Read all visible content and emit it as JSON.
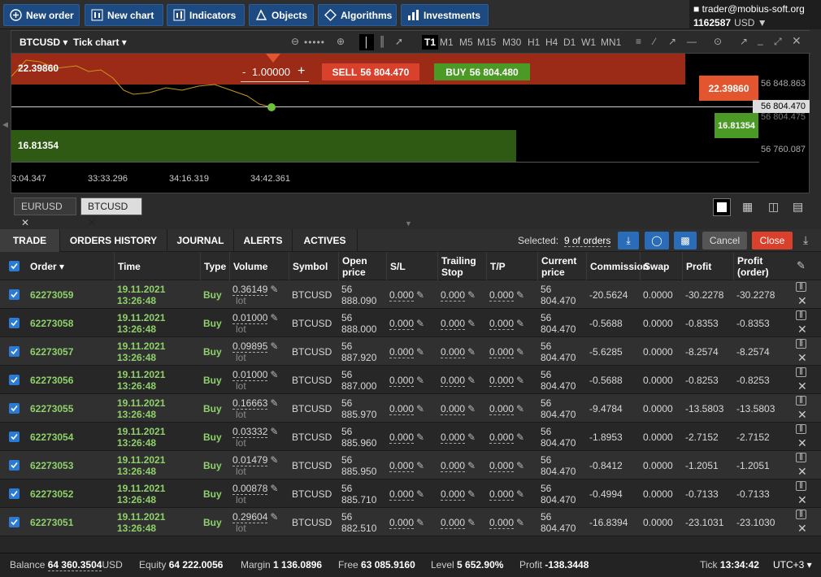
{
  "toolbar": {
    "new_order": "New order",
    "new_chart": "New chart",
    "indicators": "Indicators",
    "objects": "Objects",
    "algorithms": "Algorithms",
    "investments": "Investments"
  },
  "account": {
    "email": "trader@mobius-soft.org",
    "number": "1162587",
    "currency": "USD ▼"
  },
  "chart": {
    "symbol": "BTCUSD ▾",
    "type": "Tick chart ▾",
    "timeframes": [
      "T1",
      "M1",
      "M5",
      "M15",
      "M30",
      "H1",
      "H4",
      "D1",
      "W1",
      "MN1"
    ],
    "active_tf": "T1",
    "volume": "1.00000",
    "volume_minus": "-",
    "volume_plus": "+",
    "sell_label": "SELL",
    "sell_price": "56 804.470",
    "buy_label": "BUY",
    "buy_price": "56 804.480",
    "top_value": "22.39860",
    "top_value_badge": "22.39860",
    "bottom_value": "16.81354",
    "bottom_value_badge": "16.81354",
    "price_ticks": [
      "56 848.863",
      "56 804.470",
      "56 804.475",
      "56 760.087"
    ],
    "time_ticks": [
      "3:04.347",
      "33:33.296",
      "34:16.319",
      "34:42.361"
    ]
  },
  "chart_tabs": [
    "EURUSD",
    "BTCUSD"
  ],
  "panel": {
    "tabs": [
      "TRADE",
      "ORDERS HISTORY",
      "JOURNAL",
      "ALERTS",
      "ACTIVES"
    ],
    "selected_label": "Selected:",
    "selected_value": "9 of orders",
    "cancel": "Cancel",
    "close": "Close"
  },
  "columns": [
    "Order ▾",
    "Time",
    "Type",
    "Volume",
    "Symbol",
    "Open price",
    "S/L",
    "Trailing Stop",
    "T/P",
    "Current price",
    "Commission",
    "Swap",
    "Profit",
    "Profit (order)"
  ],
  "rows": [
    {
      "order": "62273059",
      "date": "19.11.2021",
      "time": "13:26:48",
      "type": "Buy",
      "vol": "0.36149",
      "unit": "lot",
      "sym": "BTCUSD",
      "op1": "56",
      "op2": "888.090",
      "sl": "0.000",
      "ts": "0.000",
      "tp": "0.000",
      "cp1": "56",
      "cp2": "804.470",
      "comm": "-20.5624",
      "swap": "0.0000",
      "profit": "-30.2278",
      "porder": "-30.2278"
    },
    {
      "order": "62273058",
      "date": "19.11.2021",
      "time": "13:26:48",
      "type": "Buy",
      "vol": "0.01000",
      "unit": "lot",
      "sym": "BTCUSD",
      "op1": "56",
      "op2": "888.000",
      "sl": "0.000",
      "ts": "0.000",
      "tp": "0.000",
      "cp1": "56",
      "cp2": "804.470",
      "comm": "-0.5688",
      "swap": "0.0000",
      "profit": "-0.8353",
      "porder": "-0.8353"
    },
    {
      "order": "62273057",
      "date": "19.11.2021",
      "time": "13:26:48",
      "type": "Buy",
      "vol": "0.09895",
      "unit": "lot",
      "sym": "BTCUSD",
      "op1": "56",
      "op2": "887.920",
      "sl": "0.000",
      "ts": "0.000",
      "tp": "0.000",
      "cp1": "56",
      "cp2": "804.470",
      "comm": "-5.6285",
      "swap": "0.0000",
      "profit": "-8.2574",
      "porder": "-8.2574"
    },
    {
      "order": "62273056",
      "date": "19.11.2021",
      "time": "13:26:48",
      "type": "Buy",
      "vol": "0.01000",
      "unit": "lot",
      "sym": "BTCUSD",
      "op1": "56",
      "op2": "887.000",
      "sl": "0.000",
      "ts": "0.000",
      "tp": "0.000",
      "cp1": "56",
      "cp2": "804.470",
      "comm": "-0.5688",
      "swap": "0.0000",
      "profit": "-0.8253",
      "porder": "-0.8253"
    },
    {
      "order": "62273055",
      "date": "19.11.2021",
      "time": "13:26:48",
      "type": "Buy",
      "vol": "0.16663",
      "unit": "lot",
      "sym": "BTCUSD",
      "op1": "56",
      "op2": "885.970",
      "sl": "0.000",
      "ts": "0.000",
      "tp": "0.000",
      "cp1": "56",
      "cp2": "804.470",
      "comm": "-9.4784",
      "swap": "0.0000",
      "profit": "-13.5803",
      "porder": "-13.5803"
    },
    {
      "order": "62273054",
      "date": "19.11.2021",
      "time": "13:26:48",
      "type": "Buy",
      "vol": "0.03332",
      "unit": "lot",
      "sym": "BTCUSD",
      "op1": "56",
      "op2": "885.960",
      "sl": "0.000",
      "ts": "0.000",
      "tp": "0.000",
      "cp1": "56",
      "cp2": "804.470",
      "comm": "-1.8953",
      "swap": "0.0000",
      "profit": "-2.7152",
      "porder": "-2.7152"
    },
    {
      "order": "62273053",
      "date": "19.11.2021",
      "time": "13:26:48",
      "type": "Buy",
      "vol": "0.01479",
      "unit": "lot",
      "sym": "BTCUSD",
      "op1": "56",
      "op2": "885.950",
      "sl": "0.000",
      "ts": "0.000",
      "tp": "0.000",
      "cp1": "56",
      "cp2": "804.470",
      "comm": "-0.8412",
      "swap": "0.0000",
      "profit": "-1.2051",
      "porder": "-1.2051"
    },
    {
      "order": "62273052",
      "date": "19.11.2021",
      "time": "13:26:48",
      "type": "Buy",
      "vol": "0.00878",
      "unit": "lot",
      "sym": "BTCUSD",
      "op1": "56",
      "op2": "885.710",
      "sl": "0.000",
      "ts": "0.000",
      "tp": "0.000",
      "cp1": "56",
      "cp2": "804.470",
      "comm": "-0.4994",
      "swap": "0.0000",
      "profit": "-0.7133",
      "porder": "-0.7133"
    },
    {
      "order": "62273051",
      "date": "19.11.2021",
      "time": "13:26:48",
      "type": "Buy",
      "vol": "0.29604",
      "unit": "lot",
      "sym": "BTCUSD",
      "op1": "56",
      "op2": "882.510",
      "sl": "0.000",
      "ts": "0.000",
      "tp": "0.000",
      "cp1": "56",
      "cp2": "804.470",
      "comm": "-16.8394",
      "swap": "0.0000",
      "profit": "-23.1031",
      "porder": "-23.1030"
    }
  ],
  "status": {
    "balance_label": "Balance",
    "balance": "64 360.3504",
    "balance_cur": "USD",
    "equity_label": "Equity",
    "equity": "64 222.0056",
    "margin_label": "Margin",
    "margin": "1 136.0896",
    "free_label": "Free",
    "free": "63 085.9160",
    "level_label": "Level",
    "level": "5 652.90%",
    "profit_label": "Profit",
    "profit": "-138.3448",
    "tick_label": "Tick",
    "tick": "13:34:42",
    "tz": "UTC+3 ▾"
  },
  "colors": {
    "brand": "#1d4a80",
    "sell": "#d9412c",
    "buy": "#4a9a25",
    "panel": "#262626"
  }
}
